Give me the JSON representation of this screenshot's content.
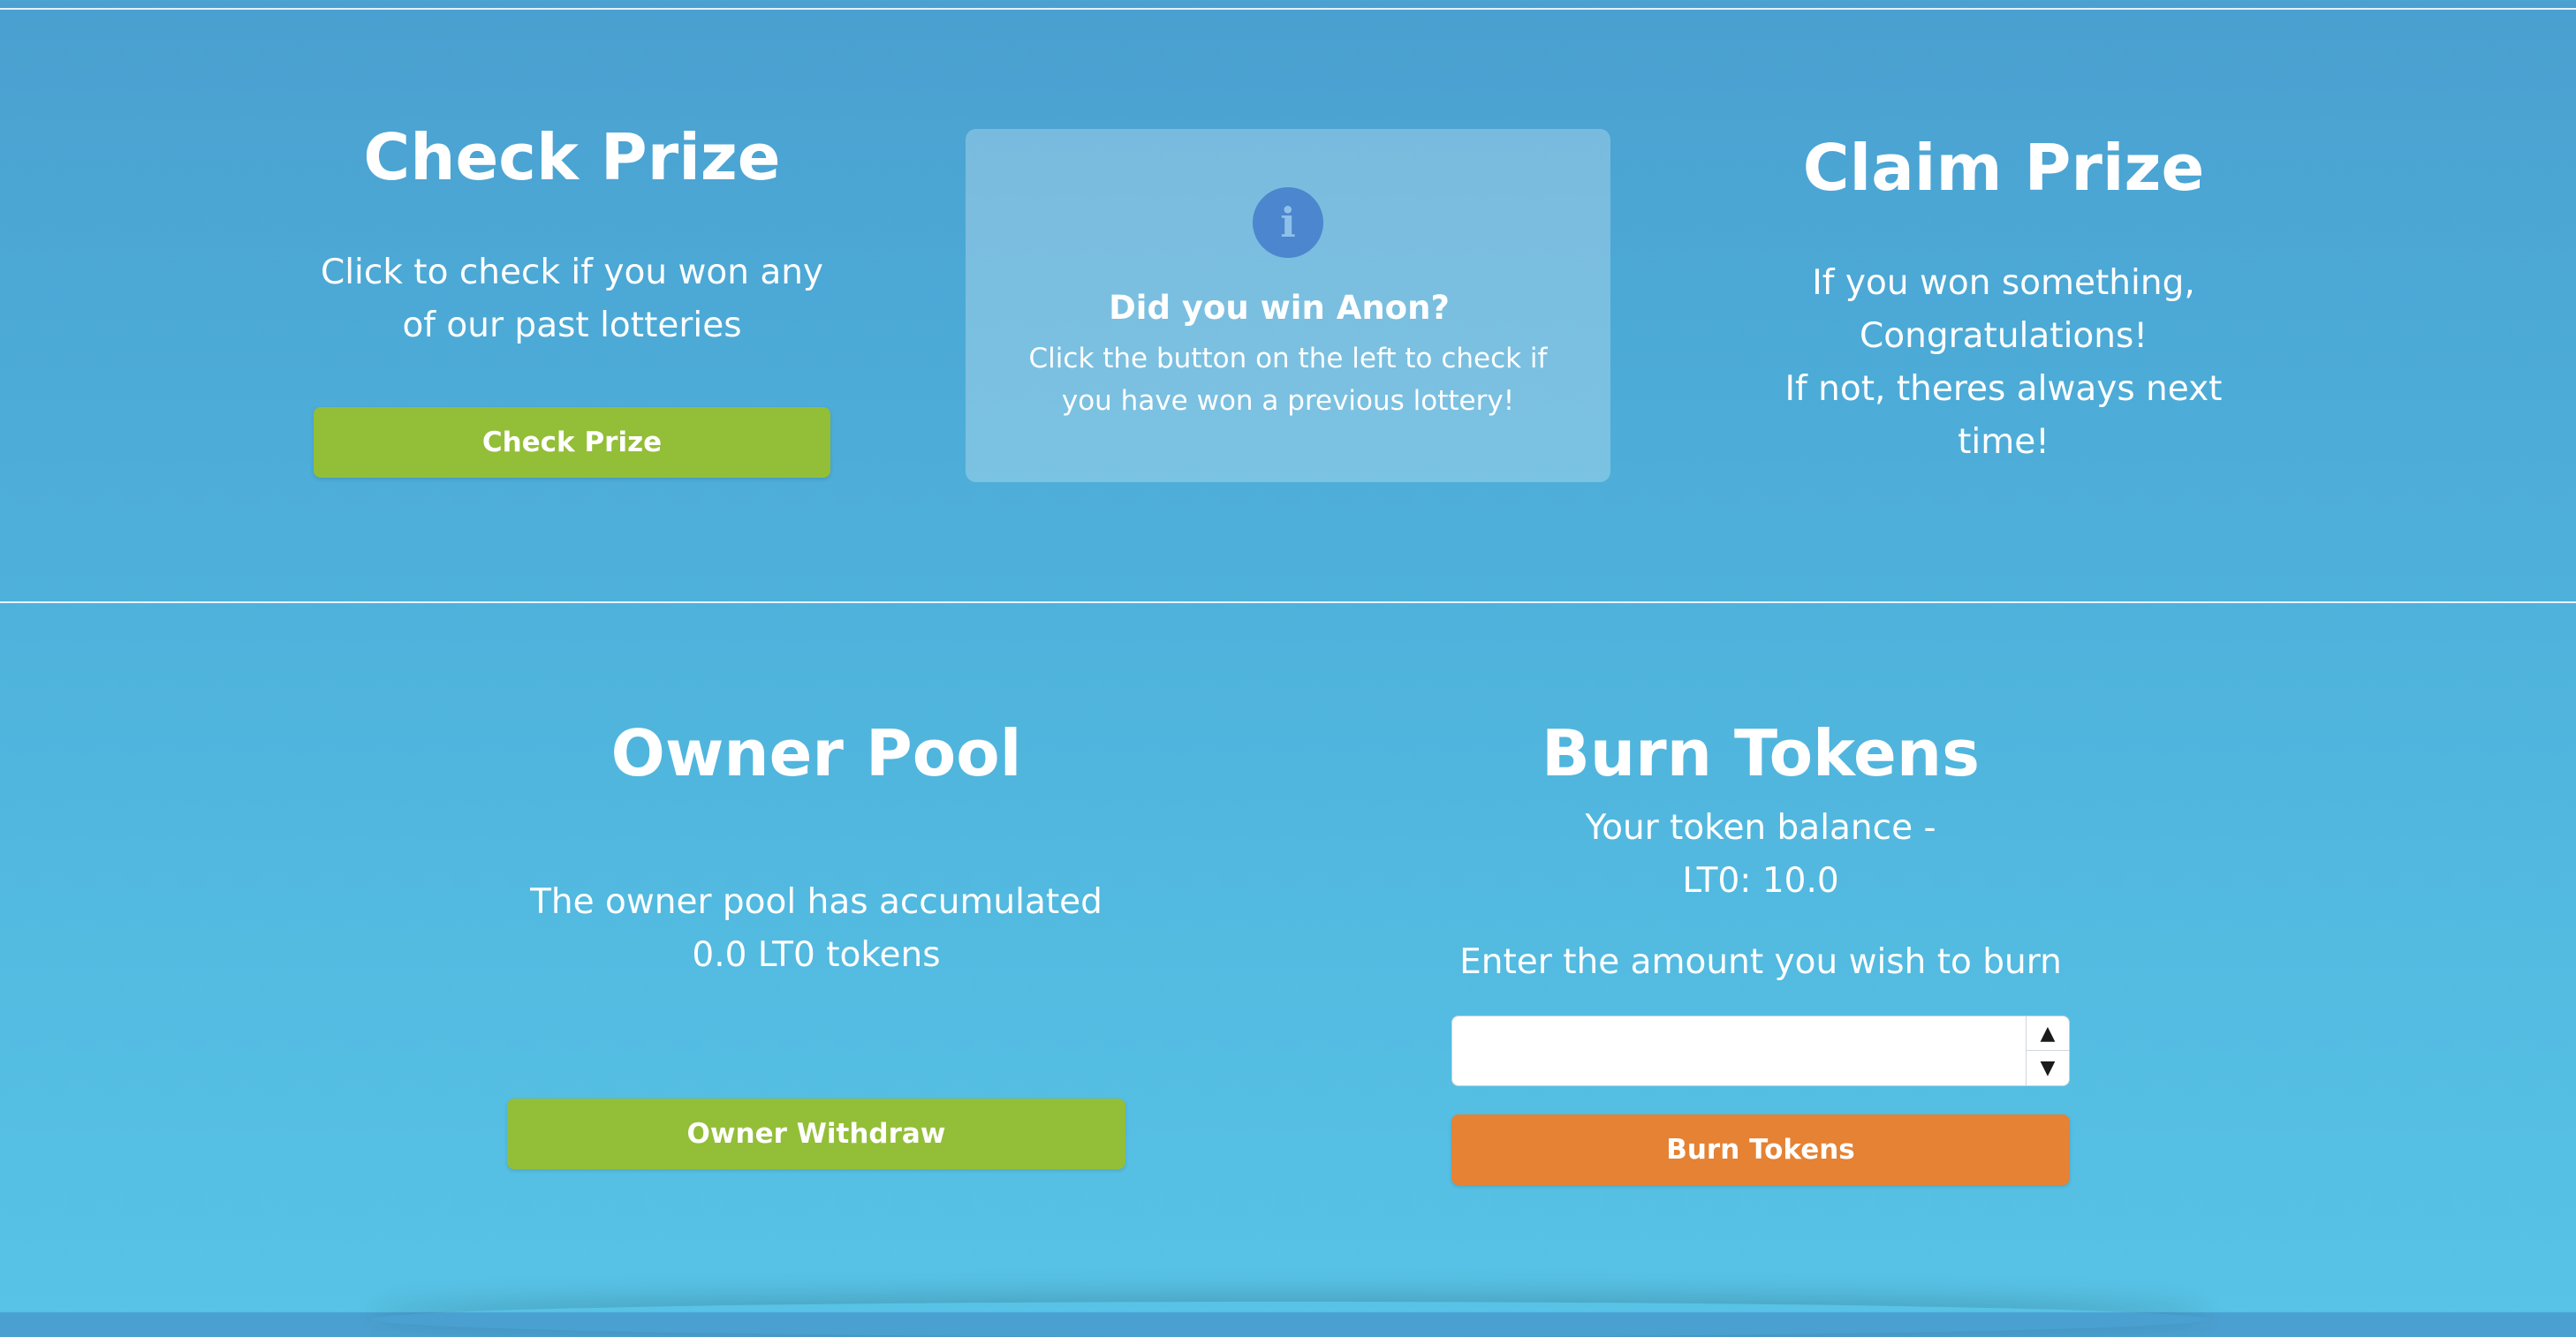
{
  "check_prize": {
    "heading": "Check Prize",
    "description": "Click to check if you won any of our past lotteries",
    "button_label": "Check Prize"
  },
  "info_card": {
    "icon": "info-icon",
    "icon_glyph": "i",
    "title": "Did you win Anon?",
    "text": "Click the button on the left to check if you have won a previous lottery!"
  },
  "claim_prize": {
    "heading": "Claim Prize",
    "line1": "If you won something,",
    "line2": "Congratulations!",
    "line3": "If not, theres always next time!"
  },
  "owner_pool": {
    "heading": "Owner Pool",
    "description": "The owner pool has accumulated 0.0 LT0 tokens",
    "button_label": "Owner Withdraw"
  },
  "burn_tokens": {
    "heading": "Burn Tokens",
    "balance_label": "Your token balance -",
    "balance_value": "LT0: 10.0",
    "prompt": "Enter the amount you wish to burn",
    "amount_value": "",
    "spinner_up": "▲",
    "spinner_down": "▼",
    "button_label": "Burn Tokens"
  },
  "colors": {
    "green_button": "#93be38",
    "orange_button": "#e58234",
    "info_icon_bg": "#4b86ce",
    "background_top": "#4aa0d0",
    "background_bottom": "#58c3e6"
  }
}
